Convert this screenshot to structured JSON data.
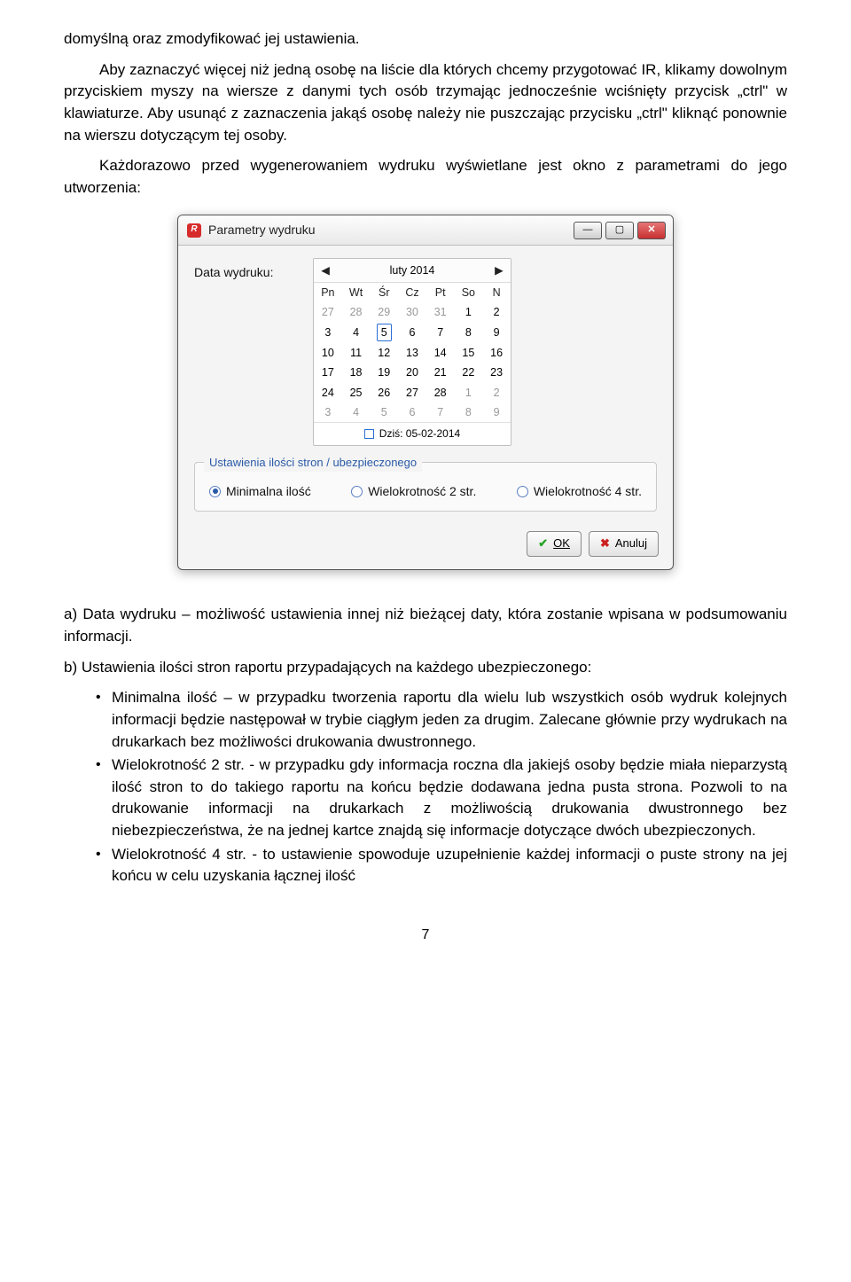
{
  "p1": "domyślną oraz zmodyfikować jej ustawienia.",
  "p2": "Aby zaznaczyć więcej niż jedną osobę na liście dla których chcemy przygotować IR, klikamy dowolnym przyciskiem myszy na wiersze z danymi tych osób trzymając jednocześnie wciśnięty przycisk „ctrl\" w klawiaturze. Aby usunąć z zaznaczenia jakąś osobę należy nie puszczając przycisku „ctrl\" kliknąć ponownie na wierszu dotyczącym tej osoby.",
  "p3": "Każdorazowo przed wygenerowaniem wydruku wyświetlane jest okno z parametrami do jego utworzenia:",
  "dialog": {
    "title": "Parametry wydruku",
    "date_label": "Data wydruku:",
    "month": "luty 2014",
    "dow": [
      "Pn",
      "Wt",
      "Śr",
      "Cz",
      "Pt",
      "So",
      "N"
    ],
    "rows": [
      [
        {
          "d": "27",
          "g": true
        },
        {
          "d": "28",
          "g": true
        },
        {
          "d": "29",
          "g": true
        },
        {
          "d": "30",
          "g": true
        },
        {
          "d": "31",
          "g": true
        },
        {
          "d": "1"
        },
        {
          "d": "2"
        }
      ],
      [
        {
          "d": "3"
        },
        {
          "d": "4"
        },
        {
          "d": "5",
          "sel": true
        },
        {
          "d": "6"
        },
        {
          "d": "7"
        },
        {
          "d": "8"
        },
        {
          "d": "9"
        }
      ],
      [
        {
          "d": "10"
        },
        {
          "d": "11"
        },
        {
          "d": "12"
        },
        {
          "d": "13"
        },
        {
          "d": "14"
        },
        {
          "d": "15"
        },
        {
          "d": "16"
        }
      ],
      [
        {
          "d": "17"
        },
        {
          "d": "18"
        },
        {
          "d": "19"
        },
        {
          "d": "20"
        },
        {
          "d": "21"
        },
        {
          "d": "22"
        },
        {
          "d": "23"
        }
      ],
      [
        {
          "d": "24"
        },
        {
          "d": "25"
        },
        {
          "d": "26"
        },
        {
          "d": "27"
        },
        {
          "d": "28"
        },
        {
          "d": "1",
          "g": true
        },
        {
          "d": "2",
          "g": true
        }
      ],
      [
        {
          "d": "3",
          "g": true
        },
        {
          "d": "4",
          "g": true
        },
        {
          "d": "5",
          "g": true
        },
        {
          "d": "6",
          "g": true
        },
        {
          "d": "7",
          "g": true
        },
        {
          "d": "8",
          "g": true
        },
        {
          "d": "9",
          "g": true
        }
      ]
    ],
    "today": "Dziś: 05-02-2014",
    "group_title": "Ustawienia ilości stron / ubezpieczonego",
    "radio1": "Minimalna ilość",
    "radio2": "Wielokrotność 2 str.",
    "radio3": "Wielokrotność 4 str.",
    "ok": "OK",
    "cancel": "Anuluj"
  },
  "a_text": "a)  Data wydruku – możliwość ustawienia innej niż bieżącej daty, która zostanie wpisana w podsumowaniu informacji.",
  "b_text": "b) Ustawienia ilości stron raportu przypadających na każdego ubezpieczonego:",
  "bullets": [
    "Minimalna ilość – w przypadku tworzenia raportu dla wielu lub wszystkich osób wydruk kolejnych informacji będzie następował w trybie ciągłym jeden za drugim. Zalecane głównie przy wydrukach na drukarkach bez możliwości drukowania dwustronnego.",
    "Wielokrotność 2 str. - w przypadku gdy informacja roczna dla jakiejś osoby będzie miała nieparzystą ilość stron to do takiego raportu na końcu będzie dodawana jedna pusta strona. Pozwoli to na drukowanie informacji na drukarkach z możliwością drukowania dwustronnego bez niebezpieczeństwa, że na jednej kartce znajdą się informacje dotyczące dwóch ubezpieczonych.",
    "Wielokrotność 4 str. - to ustawienie spowoduje uzupełnienie każdej informacji o puste strony na jej końcu w celu uzyskania łącznej ilość"
  ],
  "page_number": "7"
}
